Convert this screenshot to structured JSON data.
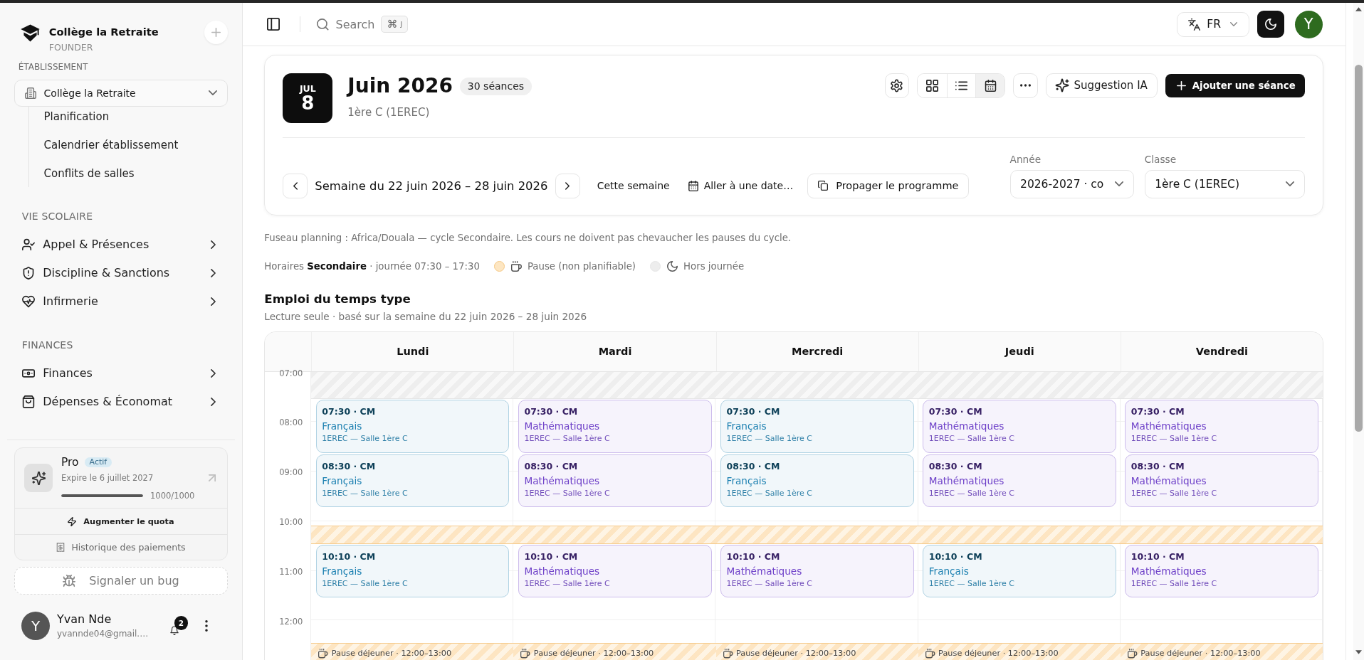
{
  "sidebar": {
    "brand": {
      "name": "Collège la Retraite",
      "role": "FOUNDER"
    },
    "school": {
      "title": "ÉTABLISSEMENT",
      "select": "Collège la Retraite",
      "items": [
        {
          "label": "Planification"
        },
        {
          "label": "Calendrier établissement"
        },
        {
          "label": "Conflits de salles"
        }
      ]
    },
    "sections": [
      {
        "title": "VIE SCOLAIRE",
        "items": [
          {
            "label": "Appel & Présences",
            "expanded": false
          },
          {
            "label": "Discipline & Sanctions",
            "expanded": false
          },
          {
            "label": "Infirmerie",
            "expanded": false
          }
        ]
      },
      {
        "title": "FINANCES",
        "items": [
          {
            "label": "Finances",
            "expanded": false
          },
          {
            "label": "Dépenses & Économat",
            "expanded": false
          }
        ]
      }
    ],
    "plan": {
      "name": "Pro",
      "status": "Actif",
      "expiry": "Expire le 6 juillet 2027",
      "level": 1,
      "usage": "1000/1000",
      "actions": [
        {
          "kind": "upgrade",
          "label": "Augmenter le quota"
        },
        {
          "kind": "history",
          "label": "Historique des paiements"
        }
      ]
    },
    "bug_button": "Signaler un bug",
    "user": {
      "initial": "Y",
      "name": "Yvan Nde",
      "email": "yvannde04@gmail.…",
      "notifications": "2"
    }
  },
  "topbar": {
    "search": {
      "label": "Search",
      "shortcut": [
        "⌘",
        "J"
      ]
    },
    "language": "FR",
    "avatar": "Y"
  },
  "planner": {
    "date": {
      "month": "JUL",
      "day": "8"
    },
    "title": "Juin 2026",
    "count": "30 séances",
    "subtitle": "1ère C (1EREC)",
    "views": [
      {
        "kind": "grid",
        "selected": false
      },
      {
        "kind": "list",
        "selected": false
      },
      {
        "kind": "calendar",
        "selected": true
      }
    ],
    "ai_button": "Suggestion IA",
    "add_button": "Ajouter une séance",
    "week": "Semaine du 22 juin 2026 – 28 juin 2026",
    "this_week": "Cette semaine",
    "go_to_date": "Aller à une date…",
    "propagate": "Propager le programme",
    "filters": [
      {
        "label": "Année",
        "value": "2026-2027 · co"
      },
      {
        "label": "Classe",
        "value": "1ère C (1EREC)"
      }
    ]
  },
  "notes": {
    "timezone": "Fuseau planning : Africa/Douala — cycle Secondaire. Les cours ne doivent pas chevaucher les pauses du cycle.",
    "hours": "Horaires **Secondaire** · journée 07:30 – 17:30",
    "legend": [
      {
        "kind": "pause",
        "label": "Pause (non planifiable)"
      },
      {
        "kind": "off_hours",
        "label": "Hors journée"
      }
    ]
  },
  "timetable": {
    "title": "Emploi du temps type",
    "subtitle": "Lecture seule · basé sur la semaine du 22 juin 2026 – 28 juin 2026",
    "days": [
      "Lundi",
      "Mardi",
      "Mercredi",
      "Jeudi",
      "Vendredi"
    ],
    "hours": [
      "07:00",
      "08:00",
      "09:00",
      "10:00",
      "11:00",
      "12:00"
    ],
    "rows": [
      {
        "kind": "off_hours"
      },
      {
        "kind": "lessons",
        "cells": [
          {
            "time": "07:30 · CM",
            "subject": "Français",
            "room": "1EREC — Salle 1ère C",
            "color": "#1a7fb0"
          },
          {
            "time": "07:30 · CM",
            "subject": "Mathématiques",
            "room": "1EREC — Salle 1ère C",
            "color": "#6d3fc8"
          },
          {
            "time": "07:30 · CM",
            "subject": "Français",
            "room": "1EREC — Salle 1ère C",
            "color": "#1a7fb0"
          },
          {
            "time": "07:30 · CM",
            "subject": "Mathématiques",
            "room": "1EREC — Salle 1ère C",
            "color": "#6d3fc8"
          },
          {
            "time": "07:30 · CM",
            "subject": "Mathématiques",
            "room": "1EREC — Salle 1ère C",
            "color": "#6d3fc8"
          }
        ]
      },
      {
        "kind": "lessons",
        "cells": [
          {
            "time": "08:30 · CM",
            "subject": "Français",
            "room": "1EREC — Salle 1ère C",
            "color": "#1a7fb0"
          },
          {
            "time": "08:30 · CM",
            "subject": "Mathématiques",
            "room": "1EREC — Salle 1ère C",
            "color": "#6d3fc8"
          },
          {
            "time": "08:30 · CM",
            "subject": "Français",
            "room": "1EREC — Salle 1ère C",
            "color": "#1a7fb0"
          },
          {
            "time": "08:30 · CM",
            "subject": "Mathématiques",
            "room": "1EREC — Salle 1ère C",
            "color": "#6d3fc8"
          },
          {
            "time": "08:30 · CM",
            "subject": "Mathématiques",
            "room": "1EREC — Salle 1ère C",
            "color": "#6d3fc8"
          }
        ]
      },
      {
        "kind": "empty"
      },
      {
        "kind": "pause"
      },
      {
        "kind": "lessons",
        "cells": [
          {
            "time": "10:10 · CM",
            "subject": "Français",
            "room": "1EREC — Salle 1ère C",
            "color": "#1a7fb0"
          },
          {
            "time": "10:10 · CM",
            "subject": "Mathématiques",
            "room": "1EREC — Salle 1ère C",
            "color": "#6d3fc8"
          },
          {
            "time": "10:10 · CM",
            "subject": "Mathématiques",
            "room": "1EREC — Salle 1ère C",
            "color": "#6d3fc8"
          },
          {
            "time": "10:10 · CM",
            "subject": "Français",
            "room": "1EREC — Salle 1ère C",
            "color": "#1a7fb0"
          },
          {
            "time": "10:10 · CM",
            "subject": "Mathématiques",
            "room": "1EREC — Salle 1ère C",
            "color": "#6d3fc8"
          }
        ]
      },
      {
        "kind": "empty"
      },
      {
        "kind": "lunch",
        "cells": [
          "Pause déjeuner · 12:00–13:00",
          "Pause déjeuner · 12:00–13:00",
          "Pause déjeuner · 12:00–13:00",
          "Pause déjeuner · 12:00–13:00",
          "Pause déjeuner · 12:00–13:00"
        ]
      }
    ]
  }
}
